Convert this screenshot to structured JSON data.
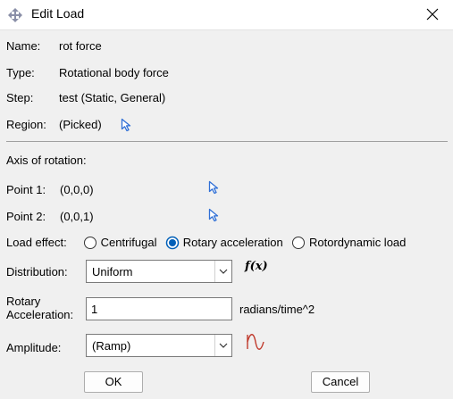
{
  "window": {
    "title": "Edit Load"
  },
  "fields": {
    "name_label": "Name:",
    "name_value": "rot force",
    "type_label": "Type:",
    "type_value": "Rotational body force",
    "step_label": "Step:",
    "step_value": "test (Static, General)",
    "region_label": "Region:",
    "region_value": "(Picked)"
  },
  "axis": {
    "heading": "Axis of rotation:",
    "point1_label": "Point 1:",
    "point1_value": "(0,0,0)",
    "point2_label": "Point 2:",
    "point2_value": "(0,0,1)"
  },
  "load_effect": {
    "label": "Load effect:",
    "options": [
      "Centrifugal",
      "Rotary acceleration",
      "Rotordynamic load"
    ],
    "selected": "Rotary acceleration"
  },
  "distribution": {
    "label": "Distribution:",
    "value": "Uniform",
    "fx": "f(x)"
  },
  "rotary": {
    "label_line1": "Rotary",
    "label_line2": "Acceleration:",
    "value": "1",
    "unit": "radians/time^2"
  },
  "amplitude": {
    "label": "Amplitude:",
    "value": "(Ramp)"
  },
  "buttons": {
    "ok": "OK",
    "cancel": "Cancel"
  },
  "colors": {
    "cursor_blue": "#2f6fd6",
    "amplitude_icon": "#c0392b",
    "selected_radio": "#005fb8"
  }
}
